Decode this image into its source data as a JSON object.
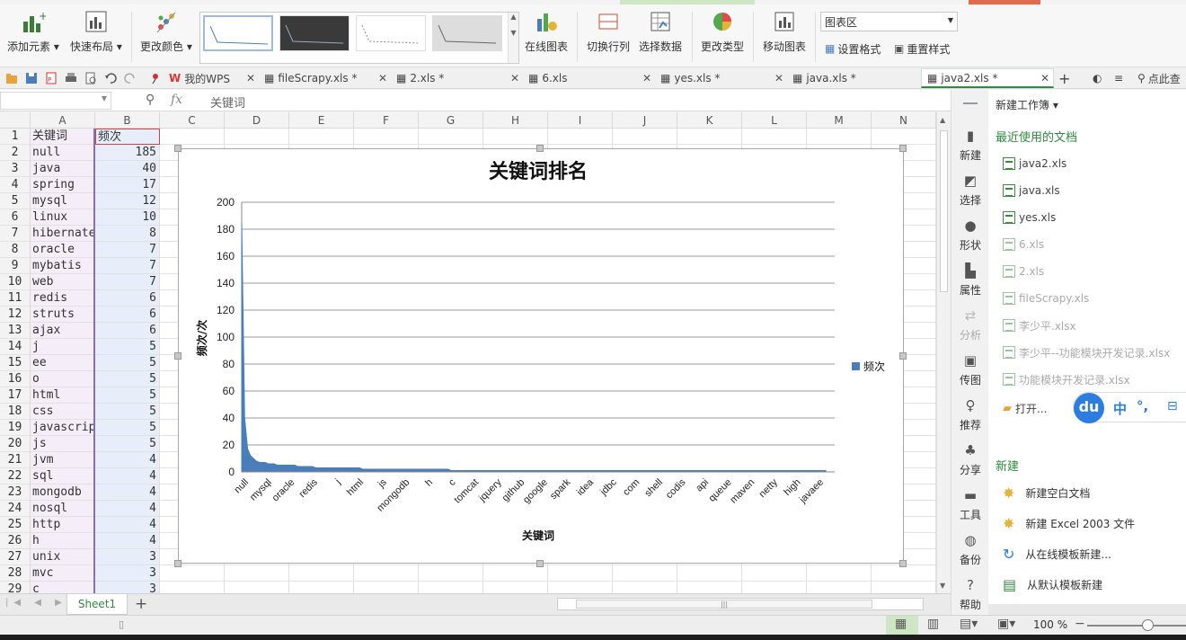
{
  "ribbon": {
    "add_element": "添加元素",
    "quick_layout": "快速布局",
    "change_color": "更改颜色",
    "online_chart": "在线图表",
    "switch_rowcol": "切换行列",
    "select_data": "选择数据",
    "change_type": "更改类型",
    "move_chart": "移动图表",
    "chart_area_select": "图表区",
    "set_format": "设置格式",
    "reset_style": "重置样式"
  },
  "tabs": [
    {
      "label": "我的WPS"
    },
    {
      "label": "fileScrapy.xls *"
    },
    {
      "label": "2.xls *"
    },
    {
      "label": "6.xls"
    },
    {
      "label": "yes.xls *"
    },
    {
      "label": "java.xls *"
    },
    {
      "label": "java2.xls *"
    }
  ],
  "tab_search": "点此查",
  "formula": {
    "fx": "fx",
    "value": "关键词"
  },
  "columns": [
    "A",
    "B",
    "C",
    "D",
    "E",
    "F",
    "G",
    "H",
    "I",
    "J",
    "K",
    "L",
    "M",
    "N"
  ],
  "rows": [
    {
      "n": "1",
      "a": "关键词",
      "b": "频次"
    },
    {
      "n": "2",
      "a": "null",
      "b": "185"
    },
    {
      "n": "3",
      "a": "java",
      "b": "40"
    },
    {
      "n": "4",
      "a": "spring",
      "b": "17"
    },
    {
      "n": "5",
      "a": "mysql",
      "b": "12"
    },
    {
      "n": "6",
      "a": "linux",
      "b": "10"
    },
    {
      "n": "7",
      "a": "hibernate",
      "b": "8"
    },
    {
      "n": "8",
      "a": "oracle",
      "b": "7"
    },
    {
      "n": "9",
      "a": "mybatis",
      "b": "7"
    },
    {
      "n": "10",
      "a": "web",
      "b": "7"
    },
    {
      "n": "11",
      "a": "redis",
      "b": "6"
    },
    {
      "n": "12",
      "a": "struts",
      "b": "6"
    },
    {
      "n": "13",
      "a": "ajax",
      "b": "6"
    },
    {
      "n": "14",
      "a": "j",
      "b": "5"
    },
    {
      "n": "15",
      "a": "ee",
      "b": "5"
    },
    {
      "n": "16",
      "a": "o",
      "b": "5"
    },
    {
      "n": "17",
      "a": "html",
      "b": "5"
    },
    {
      "n": "18",
      "a": "css",
      "b": "5"
    },
    {
      "n": "19",
      "a": "javascrip",
      "b": "5"
    },
    {
      "n": "20",
      "a": "js",
      "b": "5"
    },
    {
      "n": "21",
      "a": "jvm",
      "b": "4"
    },
    {
      "n": "22",
      "a": "sql",
      "b": "4"
    },
    {
      "n": "23",
      "a": "mongodb",
      "b": "4"
    },
    {
      "n": "24",
      "a": "nosql",
      "b": "4"
    },
    {
      "n": "25",
      "a": "http",
      "b": "4"
    },
    {
      "n": "26",
      "a": "h",
      "b": "4"
    },
    {
      "n": "27",
      "a": "unix",
      "b": "3"
    },
    {
      "n": "28",
      "a": "mvc",
      "b": "3"
    },
    {
      "n": "29",
      "a": "c",
      "b": "3"
    }
  ],
  "chart_data": {
    "type": "area",
    "title": "关键词排名",
    "xlabel": "关键词",
    "ylabel": "频次/次",
    "ylim": [
      0,
      200
    ],
    "yticks": [
      0,
      20,
      40,
      60,
      80,
      100,
      120,
      140,
      160,
      180,
      200
    ],
    "legend": "right",
    "grid": true,
    "color": "#4a7ebb",
    "x_tick_labels": [
      "null",
      "mysql",
      "oracle",
      "redis",
      "j",
      "html",
      "js",
      "mongodb",
      "h",
      "c",
      "tomcat",
      "jquery",
      "github",
      "google",
      "spark",
      "idea",
      "jdbc",
      "com",
      "shell",
      "codis",
      "api",
      "queue",
      "maven",
      "netty",
      "high",
      "javaee"
    ],
    "series": [
      {
        "name": "频次",
        "values": [
          185,
          40,
          17,
          12,
          10,
          8,
          7,
          7,
          7,
          6,
          6,
          6,
          5,
          5,
          5,
          5,
          5,
          5,
          5,
          4,
          4,
          4,
          4,
          4,
          4,
          3,
          3,
          3,
          3,
          3,
          3,
          3,
          3,
          3,
          3,
          3,
          3,
          3,
          3,
          3,
          3,
          2,
          2,
          2,
          2,
          2,
          2,
          2,
          2,
          2,
          2,
          2,
          2,
          2,
          2,
          2,
          2,
          2,
          2,
          2,
          2,
          2,
          2,
          2,
          2,
          2,
          2,
          2,
          2,
          2,
          2,
          1,
          1,
          1,
          1,
          1,
          1,
          1,
          1,
          1,
          1,
          1,
          1,
          1,
          1,
          1,
          1,
          1,
          1,
          1,
          1,
          1,
          1,
          1,
          1,
          1,
          1,
          1,
          1,
          1,
          1,
          1,
          1,
          1,
          1,
          1,
          1,
          1,
          1,
          1,
          1,
          1,
          1,
          1,
          1,
          1,
          1,
          1,
          1,
          1,
          1,
          1,
          1,
          1,
          1,
          1,
          1,
          1,
          1,
          1,
          1,
          1,
          1,
          1,
          1,
          1,
          1,
          1,
          1,
          1,
          1,
          1,
          1,
          1,
          1,
          1,
          1,
          1,
          1,
          1,
          1,
          1,
          1,
          1,
          1,
          1,
          1,
          1,
          1,
          1,
          1,
          1,
          1,
          1,
          1,
          1,
          1,
          1,
          1,
          1,
          1,
          1,
          1,
          1,
          1,
          1,
          1,
          1,
          1,
          1,
          1,
          1,
          1,
          1,
          1,
          1,
          1,
          1,
          1,
          1,
          1,
          1,
          1,
          1,
          1,
          1,
          1,
          1,
          1
        ]
      }
    ]
  },
  "sheet": {
    "name": "Sheet1",
    "add": "+"
  },
  "status": {
    "zoom": "100 %"
  },
  "sidebar": [
    {
      "label": "新建",
      "dis": false
    },
    {
      "label": "选择",
      "dis": false
    },
    {
      "label": "形状",
      "dis": false
    },
    {
      "label": "属性",
      "dis": false
    },
    {
      "label": "分析",
      "dis": true
    },
    {
      "label": "传图",
      "dis": false
    },
    {
      "label": "推荐",
      "dis": false
    },
    {
      "label": "分享",
      "dis": false
    },
    {
      "label": "工具",
      "dis": false
    },
    {
      "label": "备份",
      "dis": false
    },
    {
      "label": "帮助",
      "dis": false
    }
  ],
  "panel": {
    "title": "新建工作簿",
    "recent_title": "最近使用的文档",
    "recent": [
      {
        "name": "java2.xls",
        "dim": false
      },
      {
        "name": "java.xls",
        "dim": false
      },
      {
        "name": "yes.xls",
        "dim": false
      },
      {
        "name": "6.xls",
        "dim": true
      },
      {
        "name": "2.xls",
        "dim": true
      },
      {
        "name": "fileScrapy.xls",
        "dim": true
      },
      {
        "name": "李少平.xlsx",
        "dim": true
      },
      {
        "name": "李少平--功能模块开发记录.xlsx",
        "dim": true
      },
      {
        "name": "功能模块开发记录.xlsx",
        "dim": true
      }
    ],
    "open": "打开...",
    "ime": {
      "du": "du",
      "zh": "中",
      "punct": "°,"
    },
    "new_title": "新建",
    "new_items": [
      "新建空白文档",
      "新建 Excel 2003 文件",
      "从在线模板新建...",
      "从默认模板新建"
    ]
  }
}
